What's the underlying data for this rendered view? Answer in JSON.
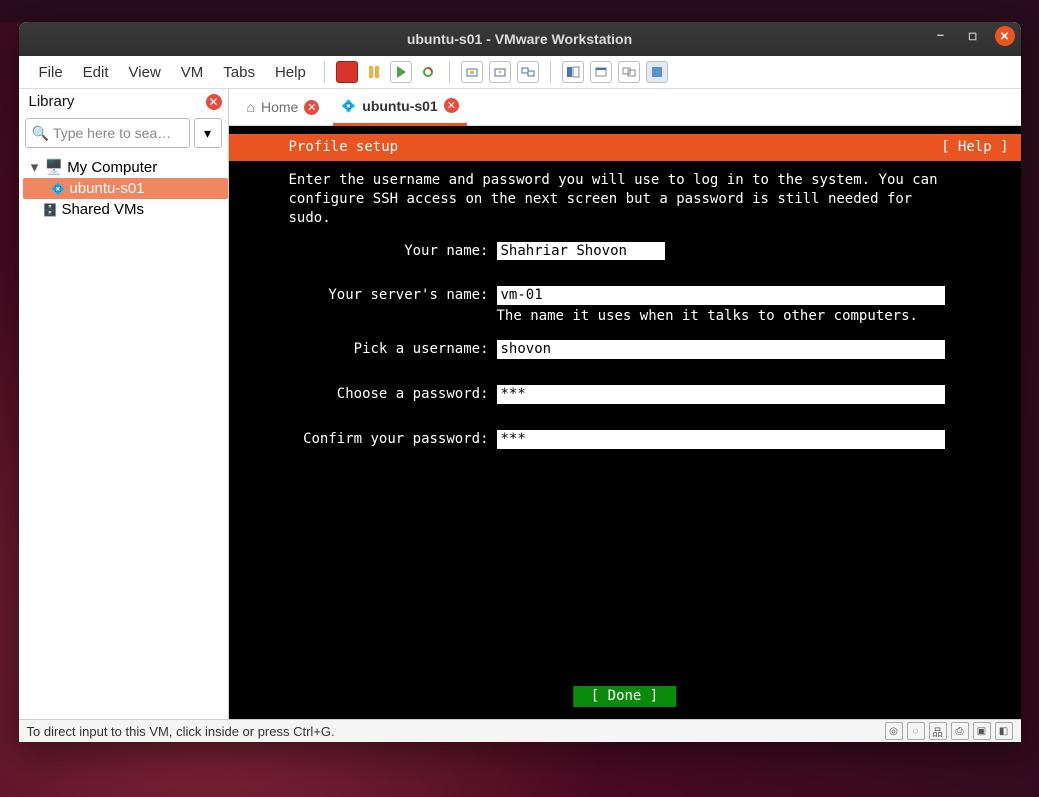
{
  "window": {
    "title": "ubuntu-s01 - VMware Workstation"
  },
  "menubar": [
    "File",
    "Edit",
    "View",
    "VM",
    "Tabs",
    "Help"
  ],
  "library": {
    "title": "Library",
    "search_placeholder": "Type here to sea…",
    "tree": {
      "root": "My Computer",
      "items": [
        "ubuntu-s01",
        "Shared VMs"
      ]
    }
  },
  "tabs": {
    "home": "Home",
    "active": "ubuntu-s01"
  },
  "installer": {
    "header": "Profile setup",
    "help": "[ Help ]",
    "intro": "Enter the username and password you will use to log in to the system. You can\nconfigure SSH access on the next screen but a password is still needed for\nsudo.",
    "labels": {
      "name": "Your name:",
      "server": "Your server's name:",
      "server_sub": "The name it uses when it talks to other computers.",
      "user": "Pick a username:",
      "pass": "Choose a password:",
      "confirm": "Confirm your password:"
    },
    "values": {
      "name": "Shahriar Shovon",
      "server": "vm-01",
      "user": "shovon",
      "pass": "***",
      "confirm": "***"
    },
    "done": "[ Done         ]"
  },
  "status": {
    "text": "To direct input to this VM, click inside or press Ctrl+G."
  }
}
